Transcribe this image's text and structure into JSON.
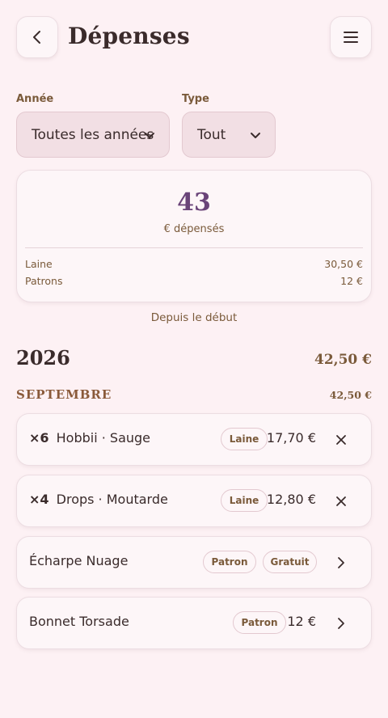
{
  "header": {
    "title": "Dépenses",
    "back_icon": "chevron-left-icon",
    "menu_icon": "hamburger-menu-icon"
  },
  "filters": {
    "year_label": "Année",
    "year_value": "Toutes les années",
    "type_label": "Type",
    "type_value": "Tout"
  },
  "summary": {
    "total": "43",
    "total_caption": "€ dépensés",
    "categories": [
      {
        "label": "Laine",
        "amount": "30,50 €"
      },
      {
        "label": "Patrons",
        "amount": "12 €"
      }
    ],
    "since": "Depuis le début"
  },
  "year_group": {
    "year": "2026",
    "year_total": "42,50 €",
    "month": "SEPTEMBRE",
    "month_total": "42,50 €"
  },
  "entries": [
    {
      "qty": "×6",
      "name": "Hobbii · Sauge",
      "tags": [
        "Laine"
      ],
      "price": "17,70 €",
      "action_icon": "close-icon"
    },
    {
      "qty": "×4",
      "name": "Drops · Moutarde",
      "tags": [
        "Laine"
      ],
      "price": "12,80 €",
      "action_icon": "close-icon"
    },
    {
      "qty": "",
      "name": "Écharpe Nuage",
      "tags": [
        "Patron",
        "Gratuit"
      ],
      "price": "",
      "action_icon": "chevron-right-icon"
    },
    {
      "qty": "",
      "name": "Bonnet Torsade",
      "tags": [
        "Patron"
      ],
      "price": "12 €",
      "action_icon": "chevron-right-icon"
    }
  ],
  "colors": {
    "background": "#fdf1f4",
    "accent": "#6a4479",
    "muted": "#7a5a3a"
  }
}
